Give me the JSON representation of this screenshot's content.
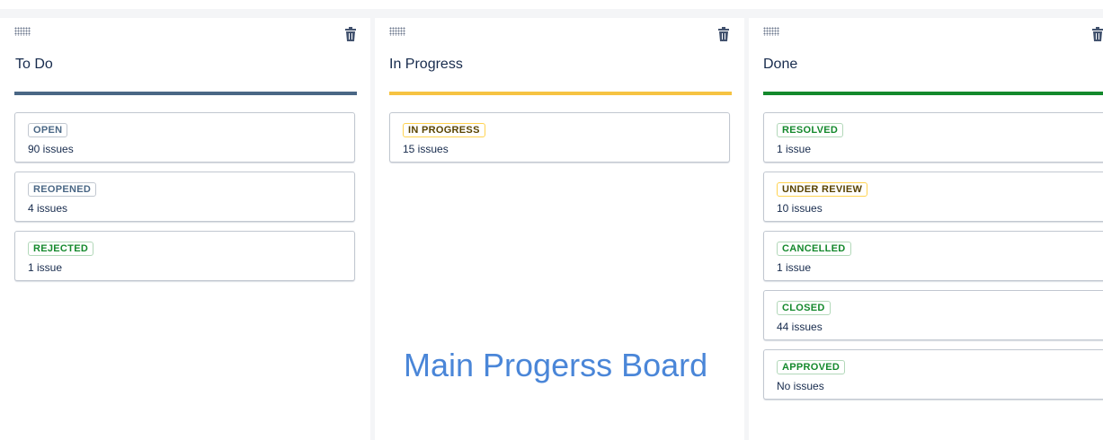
{
  "columns": [
    {
      "title": "To Do",
      "accent": "#4a6785",
      "cards": [
        {
          "status": "OPEN",
          "count": "90 issues",
          "color": "blue"
        },
        {
          "status": "REOPENED",
          "count": "4 issues",
          "color": "blue"
        },
        {
          "status": "REJECTED",
          "count": "1 issue",
          "color": "green"
        }
      ]
    },
    {
      "title": "In Progress",
      "accent": "#f6c342",
      "cards": [
        {
          "status": "IN PROGRESS",
          "count": "15 issues",
          "color": "yellow"
        }
      ]
    },
    {
      "title": "Done",
      "accent": "#14892c",
      "cards": [
        {
          "status": "RESOLVED",
          "count": "1 issue",
          "color": "green"
        },
        {
          "status": "UNDER REVIEW",
          "count": "10 issues",
          "color": "yellow"
        },
        {
          "status": "CANCELLED",
          "count": "1 issue",
          "color": "green"
        },
        {
          "status": "CLOSED",
          "count": "44 issues",
          "color": "green"
        },
        {
          "status": "APPROVED",
          "count": "No issues",
          "color": "green"
        }
      ]
    }
  ],
  "icons": {
    "drag": "drag-handle-icon",
    "delete": "trash-icon"
  },
  "watermark": "Main Progerss Board"
}
